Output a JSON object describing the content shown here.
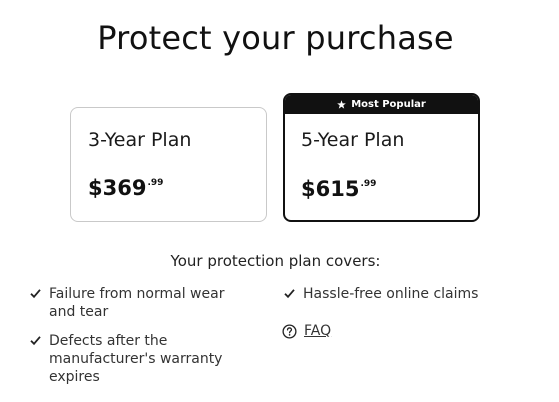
{
  "title": "Protect your purchase",
  "plans": [
    {
      "name": "3-Year Plan",
      "price_main": "$369",
      "price_cents": ".99"
    },
    {
      "name": "5-Year Plan",
      "price_main": "$615",
      "price_cents": ".99",
      "badge": "Most Popular"
    }
  ],
  "covers": {
    "heading": "Your protection plan covers:",
    "items": [
      "Failure from normal wear and tear",
      "Defects after the manufacturer's warranty expires",
      "Hassle-free online claims"
    ],
    "faq_label": "FAQ"
  },
  "icons": {
    "badge": "star-icon",
    "covers": "check-icon",
    "faq": "question-circle-icon"
  }
}
